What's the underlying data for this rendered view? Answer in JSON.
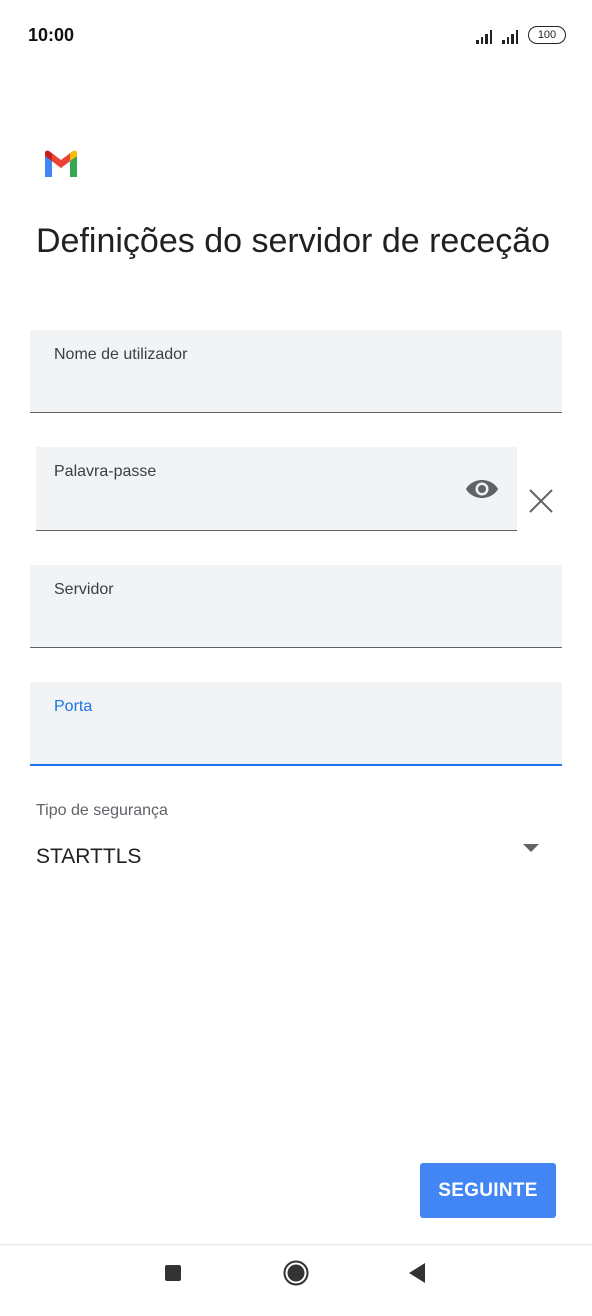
{
  "status_bar": {
    "time": "10:00",
    "battery": "100"
  },
  "logo": {
    "icon": "gmail-logo"
  },
  "page": {
    "title": "Definições do servidor de receção"
  },
  "fields": {
    "username": {
      "label": "Nome de utilizador",
      "value": ""
    },
    "password": {
      "label": "Palavra-passe",
      "value": "",
      "toggle_icon": "eye-icon",
      "clear_icon": "close-icon"
    },
    "server": {
      "label": "Servidor",
      "value": ""
    },
    "port": {
      "label": "Porta",
      "value": "",
      "focused": true
    }
  },
  "security": {
    "label": "Tipo de segurança",
    "selected": "STARTTLS"
  },
  "actions": {
    "next_label": "SEGUINTE"
  },
  "colors": {
    "accent": "#1a73e8",
    "button": "#4285f4",
    "field_bg": "#f1f3f4"
  }
}
